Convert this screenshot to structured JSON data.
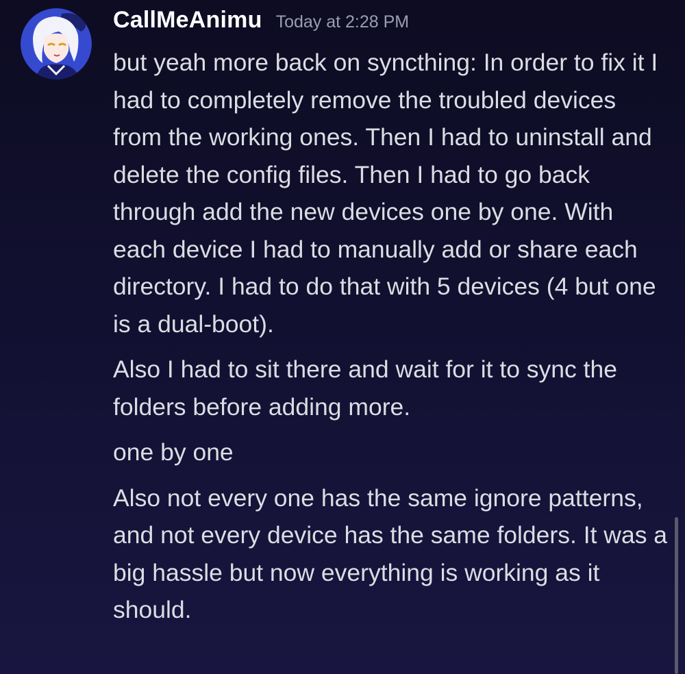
{
  "message_group": {
    "author": {
      "username": "CallMeAnimu",
      "timestamp": "Today at 2:28 PM"
    },
    "messages": [
      "but yeah more back on syncthing: In order to fix it I had to completely remove the troubled devices from the working ones. Then I had to uninstall and delete the config files. Then I had to go back through add the new devices one by one. With each device I had to manually add or share each directory. I had to do that with 5 devices (4 but one is a dual-boot).",
      "Also I had to sit there and wait for it to sync the folders before adding more.",
      "one by one",
      "Also not every one has the same ignore patterns, and not every device has the same folders. It was a big hassle but now everything is working as it should."
    ]
  },
  "colors": {
    "background": "#121030",
    "username": "#ffffff",
    "timestamp": "#9a9db0",
    "message_text": "#dcdde3",
    "scrollbar": "#5b5a6e"
  },
  "icons": {
    "avatar": "anime-character-avatar-icon"
  }
}
